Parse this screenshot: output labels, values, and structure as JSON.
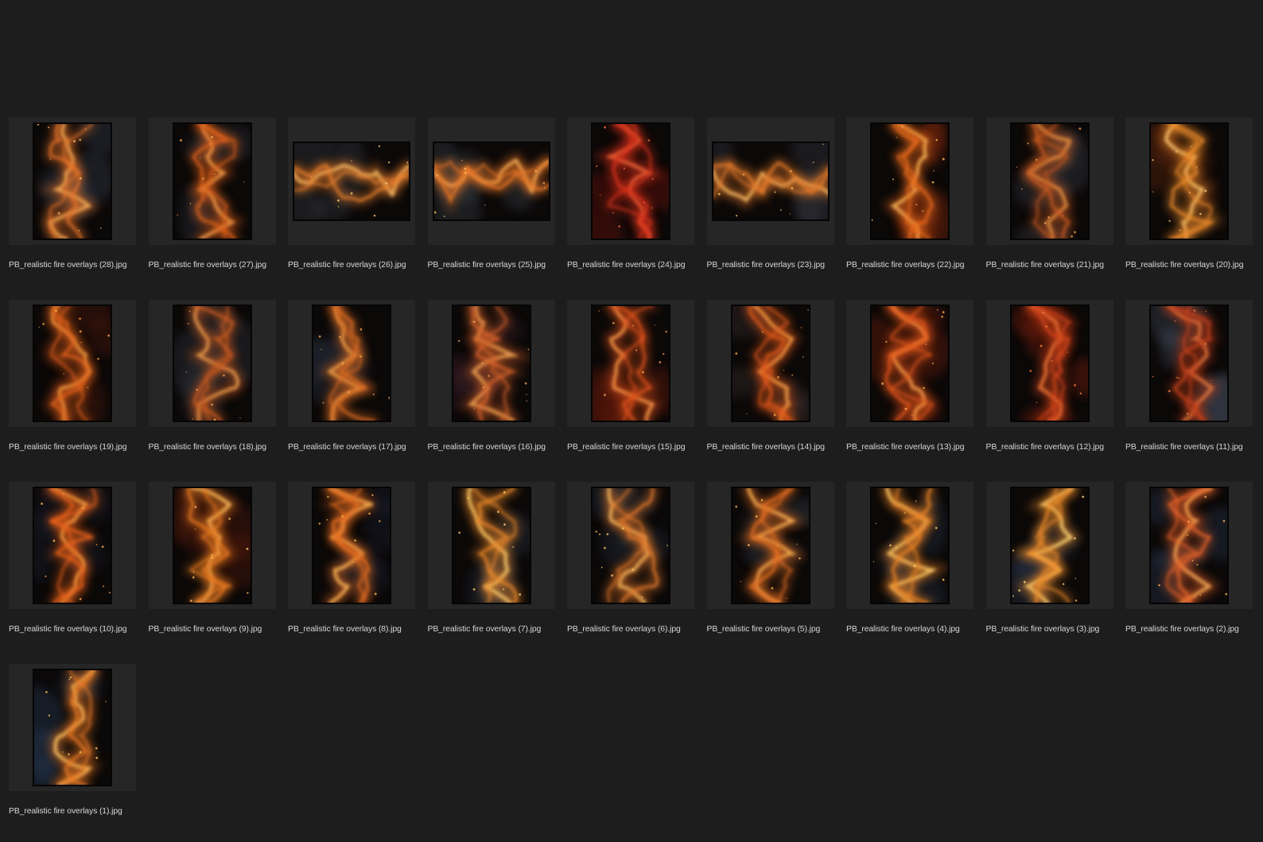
{
  "colors": {
    "background": "#1d1d1d",
    "tile": "#262626",
    "caption": "#d7d7d7"
  },
  "files": [
    {
      "name": "PB_realistic fire overlays (28).jpg",
      "orientation": "portrait",
      "palette": [
        "#e8742a",
        "#f7b25c",
        "#3a4556"
      ]
    },
    {
      "name": "PB_realistic fire overlays (27).jpg",
      "orientation": "portrait",
      "palette": [
        "#e0621f",
        "#f5a24d",
        "#2e3542"
      ]
    },
    {
      "name": "PB_realistic fire overlays (26).jpg",
      "orientation": "landscape",
      "palette": [
        "#e8802e",
        "#f9c06a",
        "#3b3f48"
      ]
    },
    {
      "name": "PB_realistic fire overlays (25).jpg",
      "orientation": "landscape",
      "palette": [
        "#e57426",
        "#f8b25a",
        "#414650"
      ]
    },
    {
      "name": "PB_realistic fire overlays (24).jpg",
      "orientation": "portrait",
      "palette": [
        "#d8321a",
        "#f26a3a",
        "#7a1810"
      ]
    },
    {
      "name": "PB_realistic fire overlays (23).jpg",
      "orientation": "landscape",
      "palette": [
        "#e47a2c",
        "#f6b864",
        "#3a3e47"
      ]
    },
    {
      "name": "PB_realistic fire overlays (22).jpg",
      "orientation": "portrait",
      "palette": [
        "#ea6a1e",
        "#fbb85a",
        "#8a2c10"
      ]
    },
    {
      "name": "PB_realistic fire overlays (21).jpg",
      "orientation": "portrait",
      "palette": [
        "#c85a22",
        "#e89446",
        "#3c3f4a"
      ]
    },
    {
      "name": "PB_realistic fire overlays (20).jpg",
      "orientation": "portrait",
      "palette": [
        "#ec8a2a",
        "#fcc870",
        "#6a2a10"
      ]
    },
    {
      "name": "PB_realistic fire overlays (19).jpg",
      "orientation": "portrait",
      "palette": [
        "#e2621c",
        "#f7a646",
        "#5a1c0c"
      ]
    },
    {
      "name": "PB_realistic fire overlays (18).jpg",
      "orientation": "portrait",
      "palette": [
        "#c75a22",
        "#e99a4c",
        "#363a44"
      ]
    },
    {
      "name": "PB_realistic fire overlays (17).jpg",
      "orientation": "portrait",
      "palette": [
        "#d96a24",
        "#f3a550",
        "#2c3240"
      ]
    },
    {
      "name": "PB_realistic fire overlays (16).jpg",
      "orientation": "portrait",
      "palette": [
        "#d4622a",
        "#f0a452",
        "#40242a"
      ]
    },
    {
      "name": "PB_realistic fire overlays (15).jpg",
      "orientation": "portrait",
      "palette": [
        "#e0521c",
        "#f8984a",
        "#6e1c10"
      ]
    },
    {
      "name": "PB_realistic fire overlays (14).jpg",
      "orientation": "portrait",
      "palette": [
        "#e25a1c",
        "#f8a448",
        "#3c3030"
      ]
    },
    {
      "name": "PB_realistic fire overlays (13).jpg",
      "orientation": "portrait",
      "palette": [
        "#e4561c",
        "#fba650",
        "#7a2410"
      ]
    },
    {
      "name": "PB_realistic fire overlays (12).jpg",
      "orientation": "portrait",
      "palette": [
        "#d2441a",
        "#f07a3a",
        "#8a2010"
      ]
    },
    {
      "name": "PB_realistic fire overlays (11).jpg",
      "orientation": "portrait",
      "palette": [
        "#c4401c",
        "#e27a40",
        "#4a5266"
      ]
    },
    {
      "name": "PB_realistic fire overlays (10).jpg",
      "orientation": "portrait",
      "palette": [
        "#e8621c",
        "#fcac4c",
        "#1e2432"
      ]
    },
    {
      "name": "PB_realistic fire overlays (9).jpg",
      "orientation": "portrait",
      "palette": [
        "#ea7a24",
        "#fdc05e",
        "#5c1c0c"
      ]
    },
    {
      "name": "PB_realistic fire overlays (8).jpg",
      "orientation": "portrait",
      "palette": [
        "#e86e22",
        "#fbb454",
        "#1c2434"
      ]
    },
    {
      "name": "PB_realistic fire overlays (7).jpg",
      "orientation": "portrait",
      "palette": [
        "#ee8a2c",
        "#fdd070",
        "#2a3444"
      ]
    },
    {
      "name": "PB_realistic fire overlays (6).jpg",
      "orientation": "portrait",
      "palette": [
        "#e2782a",
        "#f8bc62",
        "#263040"
      ]
    },
    {
      "name": "PB_realistic fire overlays (5).jpg",
      "orientation": "portrait",
      "palette": [
        "#e46e24",
        "#f9b052",
        "#2c2e36"
      ]
    },
    {
      "name": "PB_realistic fire overlays (4).jpg",
      "orientation": "portrait",
      "palette": [
        "#ec8428",
        "#fdca66",
        "#26344a"
      ]
    },
    {
      "name": "PB_realistic fire overlays (3).jpg",
      "orientation": "portrait",
      "palette": [
        "#ee8c2a",
        "#fed674",
        "#2a3648"
      ]
    },
    {
      "name": "PB_realistic fire overlays (2).jpg",
      "orientation": "portrait",
      "palette": [
        "#e8642a",
        "#fbae56",
        "#2a3a52"
      ]
    },
    {
      "name": "PB_realistic fire overlays (1).jpg",
      "orientation": "portrait",
      "palette": [
        "#ec7a26",
        "#fdc462",
        "#2c4260"
      ]
    }
  ]
}
